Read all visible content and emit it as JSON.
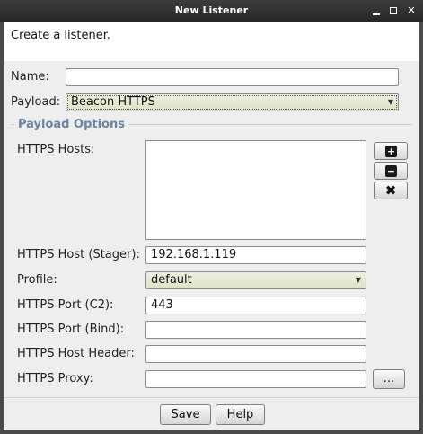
{
  "window": {
    "title": "New Listener"
  },
  "header": {
    "text": "Create a listener."
  },
  "form": {
    "name_label": "Name:",
    "name_value": "",
    "payload_label": "Payload:",
    "payload_value": "Beacon HTTPS"
  },
  "payload_options": {
    "title": "Payload Options",
    "https_hosts_label": "HTTPS Hosts:",
    "https_hosts_add": "+",
    "https_hosts_remove": "−",
    "https_hosts_clear": "✖",
    "stager_label": "HTTPS Host (Stager):",
    "stager_value": "192.168.1.119",
    "profile_label": "Profile:",
    "profile_value": "default",
    "port_c2_label": "HTTPS Port (C2):",
    "port_c2_value": "443",
    "port_bind_label": "HTTPS Port (Bind):",
    "port_bind_value": "",
    "host_header_label": "HTTPS Host Header:",
    "host_header_value": "",
    "proxy_label": "HTTPS Proxy:",
    "proxy_value": "",
    "proxy_button": "..."
  },
  "buttons": {
    "save": "Save",
    "help": "Help"
  }
}
